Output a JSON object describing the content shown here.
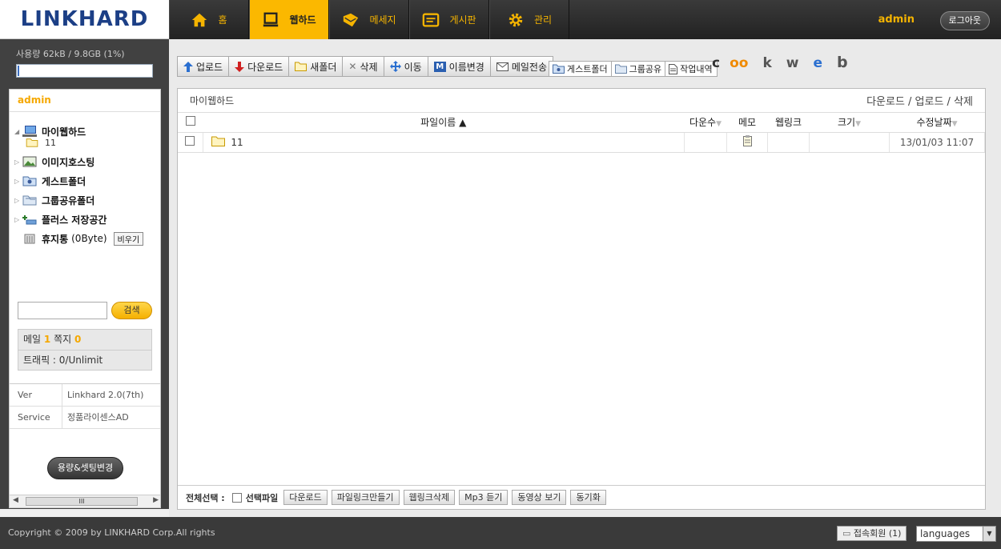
{
  "brand": {
    "logo": "LINKHARD"
  },
  "nav": [
    {
      "label": "홈",
      "icon": "home-icon"
    },
    {
      "label": "웹하드",
      "icon": "monitor-icon",
      "active": true
    },
    {
      "label": "메세지",
      "icon": "envelope-icon"
    },
    {
      "label": "게시판",
      "icon": "board-icon"
    },
    {
      "label": "관리",
      "icon": "gear-icon"
    }
  ],
  "header": {
    "user": "admin",
    "logout_label": "로그아웃"
  },
  "usage": {
    "text": "사용량 62kB / 9.8GB (1%)",
    "percent": 1
  },
  "sidebar": {
    "user": "admin",
    "tree": [
      {
        "label": "마이웹하드",
        "icon": "computer-icon",
        "sub": "11"
      },
      {
        "label": "이미지호스팅",
        "icon": "image-icon"
      },
      {
        "label": "게스트폴더",
        "icon": "guest-folder-icon"
      },
      {
        "label": "그룹공유폴더",
        "icon": "group-folder-icon"
      },
      {
        "label": "플러스 저장공간",
        "icon": "plus-storage-icon"
      }
    ],
    "trash": {
      "label": "휴지통",
      "size": "(0Byte)",
      "empty_label": "비우기"
    },
    "search_label": "검색",
    "mail_label": "메일",
    "mail_count": "1",
    "note_label": "쪽지",
    "note_count": "0",
    "traffic": "트래픽 : 0/Unlimit",
    "ver_key": "Ver",
    "ver_val": "Linkhard 2.0(7th)",
    "service_key": "Service",
    "service_val": "정품라이센스AD",
    "setting_label": "용량&셋팅변경",
    "scroll_thumb": "III"
  },
  "toolbar": {
    "upload": "업로드",
    "download": "다운로드",
    "new_folder": "새폴더",
    "delete": "삭제",
    "move": "이동",
    "rename": "이름변경",
    "mail_send": "메일전송",
    "guest_folder": "게스트폴더",
    "group_share": "그룹공유",
    "history": "작업내역"
  },
  "social": [
    "c",
    "oo",
    "k",
    "w",
    "e",
    "b"
  ],
  "content": {
    "path": "마이웹하드",
    "actions": "다운로드 / 업로드 / 삭제",
    "columns": {
      "name": "파일이름 ▲",
      "downloads": "다운수",
      "memo": "메모",
      "weblink": "웹링크",
      "size": "크기",
      "modified": "수정날짜"
    },
    "rows": [
      {
        "name": "11",
        "downloads": "",
        "memo": "memo-icon",
        "weblink": "",
        "size": "",
        "modified": "13/01/03 11:07"
      }
    ]
  },
  "footbar": {
    "select_all": "전체선택 :",
    "selected_files": "선택파일",
    "buttons": [
      "다운로드",
      "파일링크만들기",
      "웹링크삭제",
      "Mp3 듣기",
      "동영상 보기",
      "동기화"
    ]
  },
  "footer": {
    "copyright": "Copyright © 2009 by LINKHARD Corp.All rights",
    "online": "접속회원 (1)",
    "language": "languages"
  },
  "colors": {
    "accent": "#fbb800",
    "dark": "#3a3a3a",
    "brand": "#1c3f86"
  }
}
